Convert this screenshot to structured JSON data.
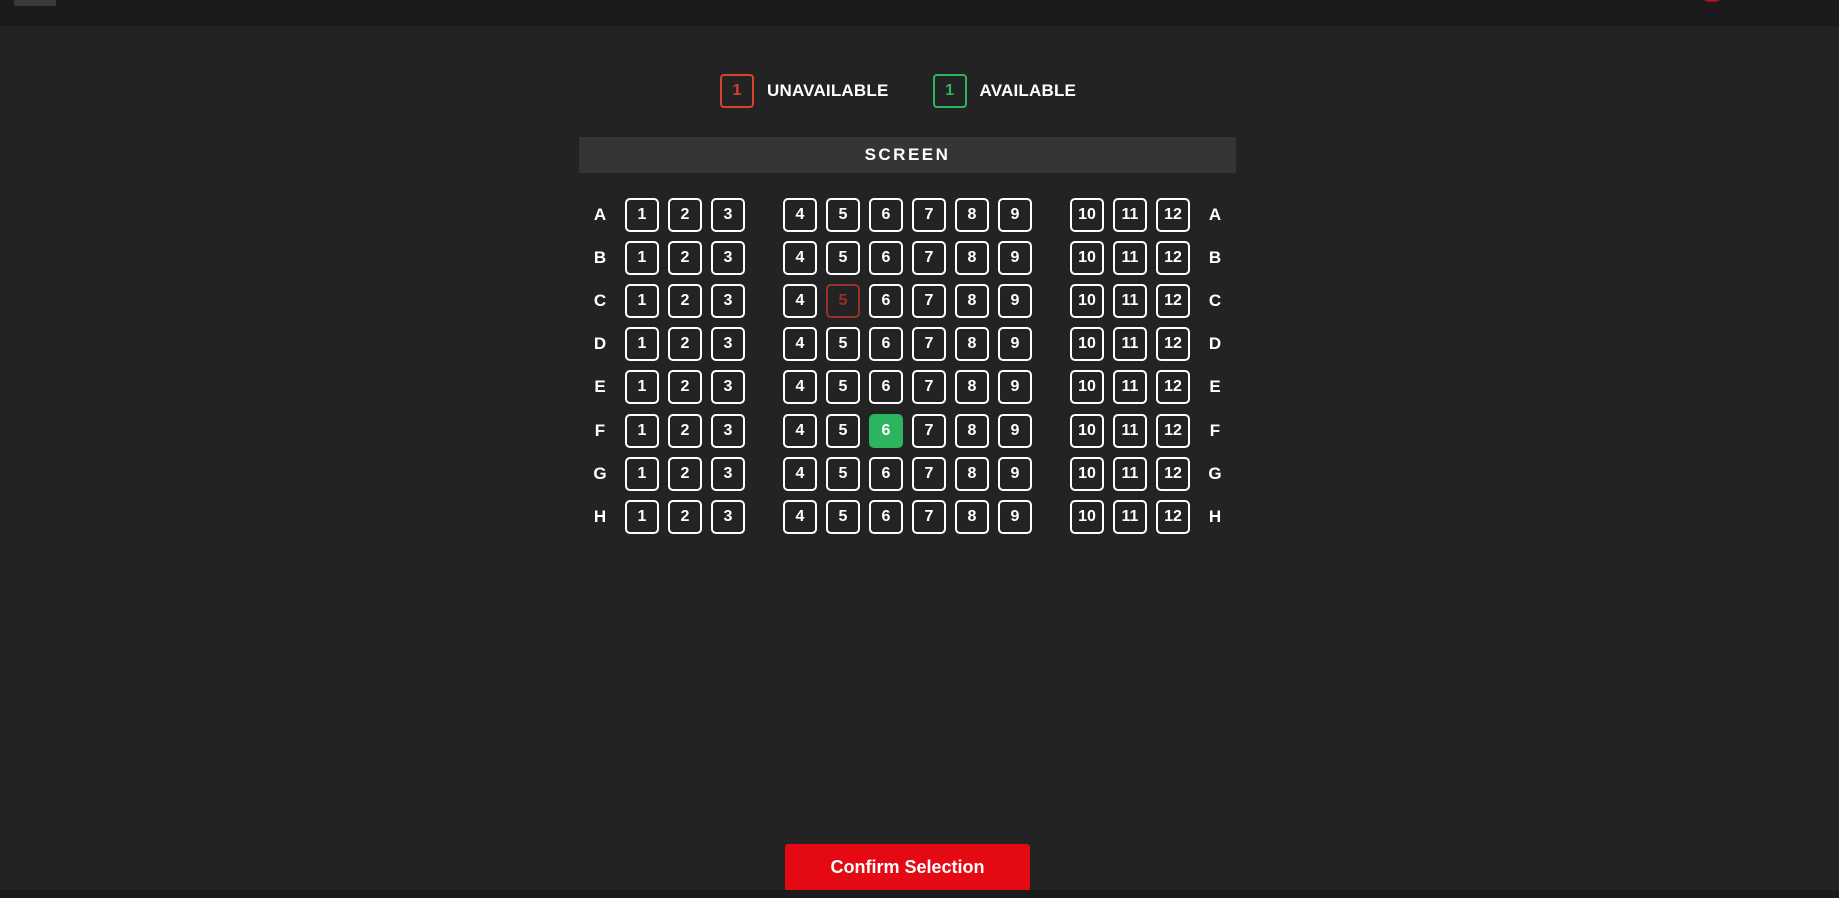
{
  "legend": {
    "unavailable": {
      "sample": "1",
      "label": "UNAVAILABLE",
      "color": "#d8432e"
    },
    "available": {
      "sample": "1",
      "label": "AVAILABLE",
      "color": "#2db45e"
    }
  },
  "screen_label": "SCREEN",
  "seat_map": {
    "rows": [
      "A",
      "B",
      "C",
      "D",
      "E",
      "F",
      "G",
      "H"
    ],
    "sections": [
      [
        "1",
        "2",
        "3"
      ],
      [
        "4",
        "5",
        "6",
        "7",
        "8",
        "9"
      ],
      [
        "10",
        "11",
        "12"
      ]
    ],
    "unavailable": [
      {
        "row": "C",
        "seat": "5"
      }
    ],
    "selected": [
      {
        "row": "F",
        "seat": "6"
      }
    ],
    "colors": {
      "selected": "#2db45e",
      "unavailable": "#9a3129",
      "seat_border": "#ffffff"
    }
  },
  "confirm_label": "Confirm Selection"
}
